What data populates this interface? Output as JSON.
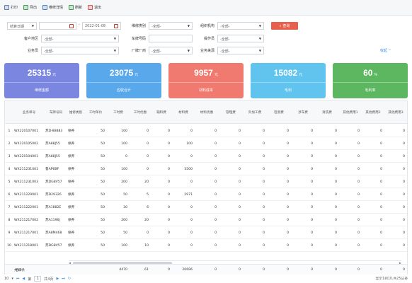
{
  "toolbar": {
    "items": [
      {
        "label": "打印",
        "icon": "printer-icon",
        "color": "#5b7fb5"
      },
      {
        "label": "导出",
        "icon": "export-icon",
        "color": "#3a9d4a"
      },
      {
        "label": "维修详情",
        "icon": "detail-icon",
        "color": "#4a7fc1"
      },
      {
        "label": "刷新",
        "icon": "refresh-icon",
        "color": "#3a9d4a"
      },
      {
        "label": "退出",
        "icon": "exit-icon",
        "color": "#d9534f"
      }
    ]
  },
  "filters": {
    "date_type": "结算日期",
    "date_end": "2022-01-08",
    "repair_type_label": "维修类别",
    "repair_type_value": "-全部-",
    "org_label": "组织机构",
    "org_value": "-全部-",
    "search_label": "查询",
    "region_label": "客户地区",
    "region_value": "-全部-",
    "plate_label": "车牌号码",
    "plate_value": "",
    "operator_label": "操作员",
    "operator_value": "-全部-",
    "staff_label": "业务员",
    "staff_value": "-全部-",
    "factory_label": "厂牌厂商",
    "factory_value": "-全部-",
    "source_label": "业务来源",
    "source_value": "-全部-",
    "collapse_label": "收起"
  },
  "cards": [
    {
      "value": "25315",
      "unit": "元",
      "label": "维修金额",
      "color": "#7b86e0"
    },
    {
      "value": "23075",
      "unit": "元",
      "label": "应收合计",
      "color": "#5aa8ec"
    },
    {
      "value": "9957",
      "unit": "元",
      "label": "材料成本",
      "color": "#f07a6f"
    },
    {
      "value": "15082",
      "unit": "元",
      "label": "毛利",
      "color": "#60c4ef"
    },
    {
      "value": "60",
      "unit": "%",
      "label": "毛利率",
      "color": "#5cb760"
    }
  ],
  "table": {
    "headers": [
      "",
      "业务单号",
      "车牌号码",
      "维修类别",
      "工时单价",
      "工时费",
      "工时优惠",
      "辅料费",
      "材料费",
      "材料优惠",
      "管理费",
      "外加工费",
      "检测费",
      "涉车费",
      "清洗费",
      "其他费用1",
      "其他费用2",
      "其他费用3"
    ],
    "rows": [
      [
        "1",
        "WX220107001",
        "苏D-88883",
        "保养",
        "50",
        "100",
        "0",
        "0",
        "0",
        "0",
        "0",
        "0",
        "0",
        "0",
        "0",
        "0",
        "0",
        "0"
      ],
      [
        "2",
        "WX220105002",
        "苏A88J55",
        "保养",
        "50",
        "100",
        "0",
        "0",
        "100",
        "0",
        "0",
        "0",
        "0",
        "0",
        "0",
        "0",
        "0",
        "0"
      ],
      [
        "3",
        "WX220104001",
        "苏A88J55",
        "保养",
        "50",
        "0",
        "0",
        "0",
        "0",
        "0",
        "0",
        "0",
        "0",
        "0",
        "0",
        "0",
        "0",
        "0"
      ],
      [
        "4",
        "WX211231001",
        "鲁AP6BF",
        "保养",
        "50",
        "100",
        "0",
        "0",
        "3500",
        "0",
        "0",
        "0",
        "0",
        "0",
        "0",
        "0",
        "0",
        "0"
      ],
      [
        "5",
        "WX211231003",
        "苏DG8V57",
        "保养",
        "50",
        "200",
        "20",
        "0",
        "0",
        "0",
        "0",
        "0",
        "0",
        "0",
        "0",
        "0",
        "0",
        "0"
      ],
      [
        "6",
        "WX211229001",
        "苏D29326",
        "保养",
        "50",
        "50",
        "5",
        "0",
        "2971",
        "0",
        "0",
        "0",
        "0",
        "0",
        "0",
        "0",
        "0",
        "0"
      ],
      [
        "7",
        "WX211222001",
        "苏A1882E",
        "保养",
        "50",
        "30",
        "6",
        "0",
        "0",
        "0",
        "0",
        "0",
        "0",
        "0",
        "0",
        "0",
        "0",
        "0"
      ],
      [
        "8",
        "WX211217002",
        "苏A1196J",
        "保养",
        "50",
        "200",
        "20",
        "0",
        "0",
        "0",
        "0",
        "0",
        "0",
        "0",
        "0",
        "0",
        "0",
        "0"
      ],
      [
        "9",
        "WX211217001",
        "苏A8M468",
        "保养",
        "50",
        "50",
        "0",
        "0",
        "0",
        "0",
        "0",
        "0",
        "0",
        "0",
        "0",
        "0",
        "0",
        "0"
      ],
      [
        "10",
        "WX211218001",
        "苏DG8V57",
        "保养",
        "50",
        "100",
        "10",
        "0",
        "0",
        "0",
        "0",
        "0",
        "0",
        "0",
        "0",
        "0",
        "0",
        "0"
      ]
    ],
    "totals": [
      "合计",
      "共25条",
      "",
      "",
      "",
      "4470",
      "61",
      "0",
      "20696",
      "0",
      "0",
      "0",
      "0",
      "0",
      "0",
      "0",
      "0",
      "0"
    ]
  },
  "pager": {
    "page_size": "10",
    "page_prefix": "第",
    "page_current": "1",
    "page_total": "共4页",
    "info": "显示1到10,共25记录"
  }
}
